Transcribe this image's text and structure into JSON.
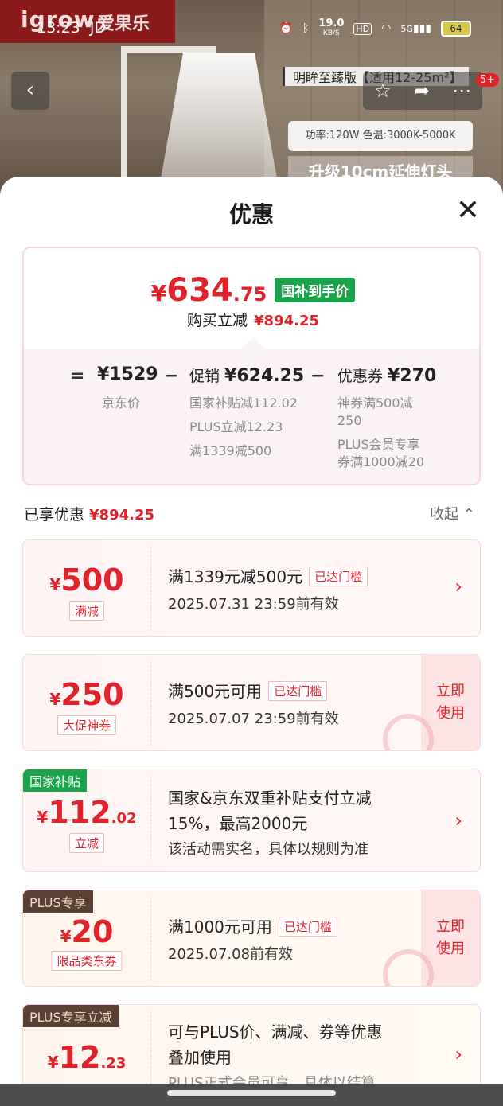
{
  "status_bar": {
    "time": "13:23",
    "app_tag": "JD",
    "net_speed": "19.0",
    "net_unit": "KB/S",
    "hd": "HD",
    "signal": "5G",
    "battery": "64"
  },
  "background": {
    "brand_logo": "igrow",
    "brand_cn": "爱果乐",
    "product_title": "明眸至臻版【适用12-25m²】",
    "cart_badge": "5+",
    "spec_line": "功率:120W   色温:3000K-5000K",
    "promo_line": "升级10cm延伸灯头",
    "icons": [
      "back-arrow-icon",
      "star-icon",
      "share-icon",
      "more-icon"
    ]
  },
  "sheet": {
    "title": "优惠",
    "close_glyph": "✕",
    "summary": {
      "final_yen": "¥",
      "final_int": "634",
      "final_dec": ".75",
      "final_tag": "国补到手价",
      "buy_label": "购买立减",
      "buy_value": "¥894.25",
      "eq_sign": "=",
      "minus_sign": "−",
      "jd_price_value": "¥1529",
      "jd_price_label": "京东价",
      "promo_label": "促销",
      "promo_value": "¥624.25",
      "promo_details": [
        "国家补贴减112.02",
        "PLUS立减12.23",
        "满1339减500"
      ],
      "coupon_label": "优惠券",
      "coupon_value": "¥270",
      "coupon_details": [
        "神券满500减",
        "250",
        "PLUS会员专享",
        "券满1000减20"
      ]
    },
    "enjoyed_label": "已享优惠",
    "enjoyed_value": "¥894.25",
    "collapse_label": "收起",
    "collapse_glyph": "⌃",
    "coupons": [
      {
        "yen": "¥",
        "amount": "500",
        "dec": "",
        "type": "满减",
        "line1": "满1339元减500元",
        "reached": "已达门槛",
        "line2": "2025.07.31 23:59前有效",
        "action": "›"
      },
      {
        "yen": "¥",
        "amount": "250",
        "dec": "",
        "type": "大促神券",
        "line1": "满500元可用",
        "reached": "已达门槛",
        "line2": "2025.07.07 23:59前有效",
        "action_line1": "立即",
        "action_line2": "使用"
      },
      {
        "corner_tag": "国家补贴",
        "yen": "¥",
        "amount": "112",
        "dec": ".02",
        "type": "立减",
        "line1a": "国家&京东双重补贴支付立减",
        "line1b": "15%，最高2000元",
        "line2": "该活动需实名，具体以规则为准",
        "action": "›"
      },
      {
        "corner_tag": "PLUS专享",
        "yen": "¥",
        "amount": "20",
        "dec": "",
        "type": "限品类东券",
        "line1": "满1000元可用",
        "reached": "已达门槛",
        "line2": "2025.07.08前有效",
        "action_line1": "立即",
        "action_line2": "使用"
      },
      {
        "corner_tag": "PLUS专享立减",
        "yen": "¥",
        "amount": "12",
        "dec": ".23",
        "line1a": "可与PLUS价、满减、券等优惠",
        "line1b": "叠加使用",
        "line2": "PLUS正式会员可享，具体以结算…",
        "action": "›"
      }
    ]
  },
  "colors": {
    "accent_red": "#e0232b",
    "subsidy_green": "#1aa34a",
    "plus_brown": "#5a4034"
  }
}
